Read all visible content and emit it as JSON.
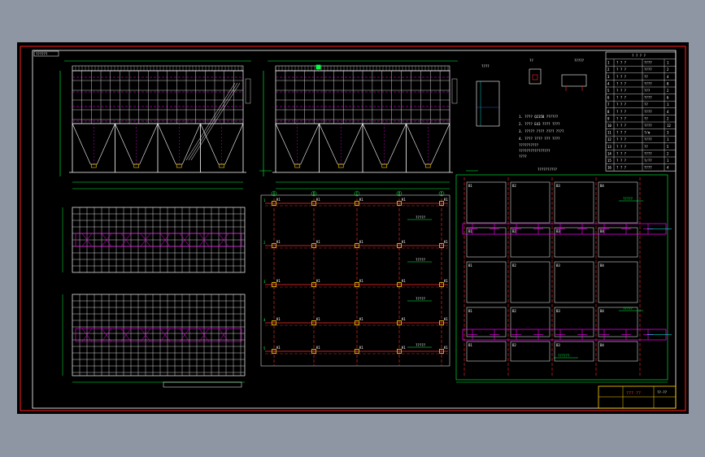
{
  "sheet": {
    "stamp_label": "??????",
    "colors": {
      "background": "#000000",
      "frame": "#ff2020",
      "inner_frame": "#ffffff",
      "structure": "#ffffff",
      "axis": "#ff3030",
      "dimension": "#00ff40",
      "column": "#ffd000",
      "beam_red": "#ff2828",
      "magenta": "#ff00ff",
      "cyan": "#00ffff",
      "blue": "#4060ff"
    }
  },
  "elevation_views": {
    "left_hopper_count": 4,
    "right_hopper_count": 4
  },
  "section_views": {
    "section_a_label": "????",
    "section_b_label": "??",
    "section_c_label": "?????"
  },
  "notes": [
    "1. ???? Q235B ??????",
    "2. ????  E43 ???? ????",
    "3. ????? ???? ???? ????",
    "4. ????  ???? ??? ????",
    "??????????",
    "????????????????",
    "????"
  ],
  "material_table": {
    "header": "? ? ? ?",
    "rows": [
      {
        "idx": "1",
        "name": "? ? ?",
        "spec": "????",
        "qty": "1"
      },
      {
        "idx": "2",
        "name": "? ? ?",
        "spec": "????",
        "qty": "2"
      },
      {
        "idx": "3",
        "name": "? ? ?",
        "spec": "??",
        "qty": "4"
      },
      {
        "idx": "4",
        "name": "? ? ?",
        "spec": "????",
        "qty": "8"
      },
      {
        "idx": "5",
        "name": "? ? ?",
        "spec": "???",
        "qty": "2"
      },
      {
        "idx": "6",
        "name": "? ? ?",
        "spec": "????",
        "qty": "6"
      },
      {
        "idx": "7",
        "name": "? ? ?",
        "spec": "??",
        "qty": "1"
      },
      {
        "idx": "8",
        "name": "? ? ?",
        "spec": "????",
        "qty": "4"
      },
      {
        "idx": "9",
        "name": "? ? ?",
        "spec": "??",
        "qty": "2"
      },
      {
        "idx": "10",
        "name": "? ? ?",
        "spec": "????",
        "qty": "12"
      },
      {
        "idx": "11",
        "name": "? ? ?",
        "spec": "?/m",
        "qty": "3"
      },
      {
        "idx": "12",
        "name": "? ? ?",
        "spec": "????",
        "qty": "1"
      },
      {
        "idx": "13",
        "name": "? ? ?",
        "spec": "??",
        "qty": "5"
      },
      {
        "idx": "14",
        "name": "? ? ?",
        "spec": "????",
        "qty": "2"
      },
      {
        "idx": "15",
        "name": "? ? ?",
        "spec": "?/??",
        "qty": "1"
      },
      {
        "idx": "16",
        "name": "? ? ?",
        "spec": "????",
        "qty": "4"
      }
    ]
  },
  "column_plan": {
    "axis_labels_row": [
      "A",
      "B",
      "C",
      "D",
      "E"
    ],
    "axis_labels_col": [
      "1",
      "2",
      "3",
      "4",
      "5"
    ],
    "column_tag": "K1",
    "callouts": [
      "?????",
      "?????",
      "?????",
      "?????"
    ]
  },
  "foundation_plan": {
    "title": "??????????",
    "panel_tags": [
      "B1",
      "B2",
      "B3",
      "B4"
    ],
    "callouts": [
      "?????",
      "?????",
      "??????"
    ]
  },
  "title_block": {
    "drawing_name": "??? ??",
    "code": "??-??"
  }
}
